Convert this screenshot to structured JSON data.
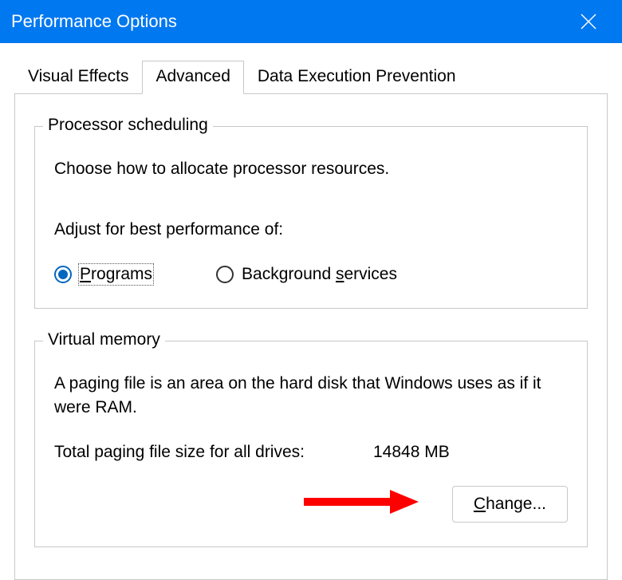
{
  "window": {
    "title": "Performance Options"
  },
  "tabs": {
    "visual_effects": "Visual Effects",
    "advanced": "Advanced",
    "dep": "Data Execution Prevention",
    "active": "advanced"
  },
  "processor_scheduling": {
    "legend": "Processor scheduling",
    "intro": "Choose how to allocate processor resources.",
    "adjust_label": "Adjust for best performance of:",
    "programs_prefix": "P",
    "programs_rest": "rograms",
    "services_prefix": "Background ",
    "services_underline": "s",
    "services_rest": "ervices",
    "selected": "programs"
  },
  "virtual_memory": {
    "legend": "Virtual memory",
    "description": "A paging file is an area on the hard disk that Windows uses as if it were RAM.",
    "total_label": "Total paging file size for all drives:",
    "total_value": "14848 MB",
    "change_underline": "C",
    "change_rest": "hange..."
  }
}
